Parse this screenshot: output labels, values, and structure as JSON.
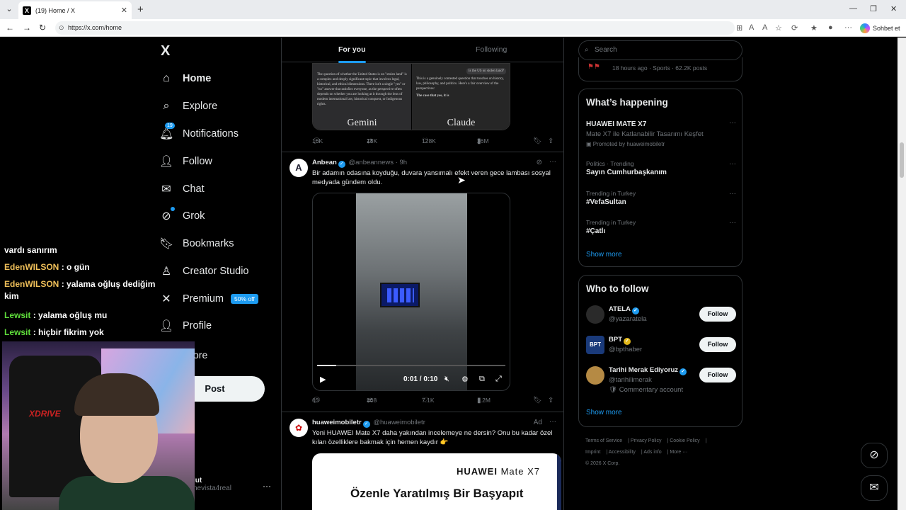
{
  "browser": {
    "tab_title": "(19) Home / X",
    "url": "https://x.com/home",
    "copilot_label": "Sohbet et"
  },
  "nav": {
    "logo": "X",
    "items": [
      {
        "label": "Home",
        "icon": "home-icon"
      },
      {
        "label": "Explore",
        "icon": "search-icon"
      },
      {
        "label": "Notifications",
        "icon": "bell-icon",
        "badge": "19"
      },
      {
        "label": "Follow",
        "icon": "person-add-icon"
      },
      {
        "label": "Chat",
        "icon": "mail-icon"
      },
      {
        "label": "Grok",
        "icon": "grok-icon"
      },
      {
        "label": "Bookmarks",
        "icon": "bookmark-icon"
      },
      {
        "label": "Creator Studio",
        "icon": "creator-icon"
      },
      {
        "label": "Premium",
        "icon": "x-icon",
        "badge": "50% off"
      },
      {
        "label": "Profile",
        "icon": "person-icon"
      }
    ],
    "more_partial": "ore",
    "post_label": "Post",
    "account_name_partial": "lut",
    "account_handle_partial": "nevista4real"
  },
  "chat_overlay": [
    {
      "user": "",
      "message": "vardı sanırım"
    },
    {
      "user": "EdenWILSON",
      "message": ": o gün"
    },
    {
      "user": "EdenWILSON",
      "message": ": yalama oğluş dediğim kim"
    },
    {
      "user": "Lewsit",
      "message": ": yalama oğluş mu"
    },
    {
      "user": "Lewsit",
      "message": ": hiçbir fikrim yok"
    }
  ],
  "feed": {
    "tabs": [
      "For you",
      "Following"
    ],
    "tweet1": {
      "image_left_text": "The question of whether the United States is on \"stolen land\" is a complex and deeply significant topic that involves legal, historical, and ethical dimensions. There isn't a single \"yes\" or \"no\" answer that satisfies everyone, as the perspective often depends on whether you are looking at it through the lens of modern international law, historical conquest, or Indigenous rights.",
      "image_left_name": "Gemini",
      "image_right_question": "Is the US on stolen land?",
      "image_right_text": "This is a genuinely contested question that touches on history, law, philosophy, and politics. Here's a fair overview of the perspectives:",
      "image_right_text2": "The case that yes, it is",
      "image_right_name": "Claude",
      "replies": "16K",
      "reposts": "18K",
      "likes": "128K",
      "views": "26M"
    },
    "tweet2": {
      "name": "Anbean",
      "handle": "@anbeannews",
      "time": "· 9h",
      "text": "Bir adamın odasına koyduğu, duvara yansımalı efekt veren gece lambası sosyal medyada gündem oldu.",
      "video_time": "0:01 / 0:10",
      "video_progress": 0.1,
      "replies": "63",
      "reposts": "308",
      "likes": "7.1K",
      "views": "1.2M"
    },
    "tweet3": {
      "name": "huaweimobiletr",
      "handle": "@huaweimobiletr",
      "ad_label": "Ad",
      "text": "Yeni HUAWEI Mate X7 daha yakından incelemeye ne dersin? Onu bu kadar özel kılan özelliklere bakmak için hemen kaydır 👉",
      "image_brand": "HUAWEI",
      "image_model": "Mate X7",
      "image_headline": "Özenle Yaratılmış Bir Başyapıt"
    }
  },
  "sidebar": {
    "search_placeholder": "Search",
    "top_card_meta": "18 hours ago · Sports · 62.2K posts",
    "whats_happening": {
      "title": "What’s happening",
      "trends": [
        {
          "context": "",
          "name": "HUAWEI MATE X7",
          "sub": "Mate X7 ile Katlanabilir Tasarımı Keşfet",
          "promo": "Promoted by huaweimobiletr"
        },
        {
          "context": "Politics · Trending",
          "name": "Sayın Cumhurbaşkanım"
        },
        {
          "context": "Trending in Turkey",
          "name": "#VefaSultan"
        },
        {
          "context": "Trending in Turkey",
          "name": "#Çatlı"
        }
      ],
      "show_more": "Show more"
    },
    "who_to_follow": {
      "title": "Who to follow",
      "accounts": [
        {
          "name": "ATELA",
          "handle": "@yazaratela",
          "verified": "blue",
          "button": "Follow"
        },
        {
          "name": "BPT",
          "handle": "@bpthaber",
          "verified": "gold",
          "button": "Follow"
        },
        {
          "name": "Tarihi Merak Ediyoruz",
          "handle": "@tarihilimerak",
          "verified": "blue",
          "extra": "Commentary account",
          "button": "Follow"
        }
      ],
      "show_more": "Show more"
    },
    "footer": {
      "links": [
        "Terms of Service",
        "Privacy Policy",
        "Cookie Policy",
        "Imprint",
        "Accessibility",
        "Ads info",
        "More ···"
      ],
      "copyright": "© 2026 X Corp."
    }
  },
  "colors": {
    "accent": "#1d9bf0",
    "background": "#000000",
    "text": "#e7e9ea",
    "muted": "#71767b",
    "border": "#2f3336"
  }
}
